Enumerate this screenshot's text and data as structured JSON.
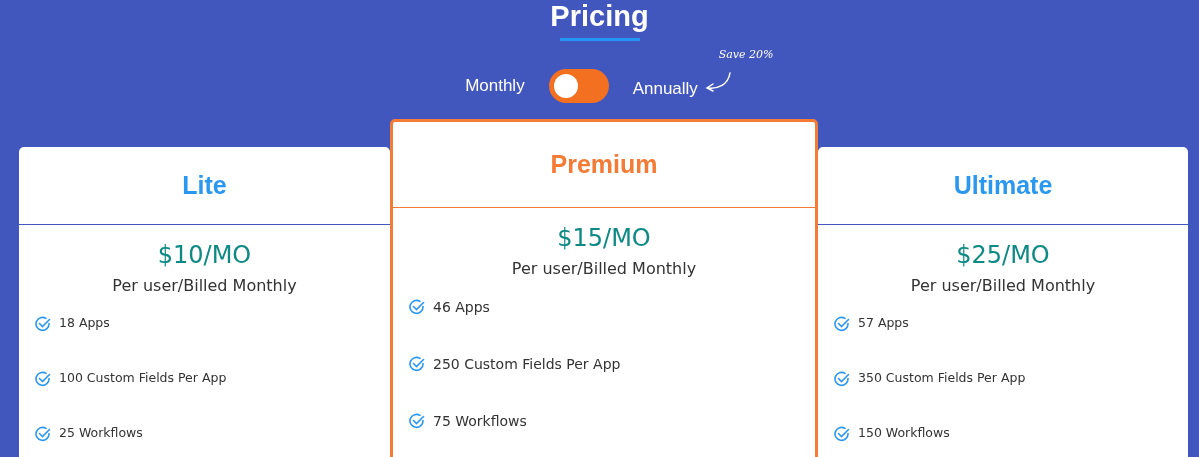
{
  "title": "Pricing",
  "billing_toggle": {
    "left_label": "Monthly",
    "right_label": "Annually",
    "on": false,
    "note": "Save 20%"
  },
  "plans": [
    {
      "name": "Lite",
      "featured": false,
      "price": "$10/MO",
      "billing": "Per user/Billed Monthly",
      "features": [
        "18 Apps",
        "100 Custom Fields Per App",
        "25 Workflows"
      ]
    },
    {
      "name": "Premium",
      "featured": true,
      "price": "$15/MO",
      "billing": "Per user/Billed Monthly",
      "features": [
        "46 Apps",
        "250 Custom Fields Per App",
        "75 Workflows"
      ]
    },
    {
      "name": "Ultimate",
      "featured": false,
      "price": "$25/MO",
      "billing": "Per user/Billed Monthly",
      "features": [
        "57 Apps",
        "350 Custom Fields Per App",
        "150 Workflows"
      ]
    }
  ]
}
